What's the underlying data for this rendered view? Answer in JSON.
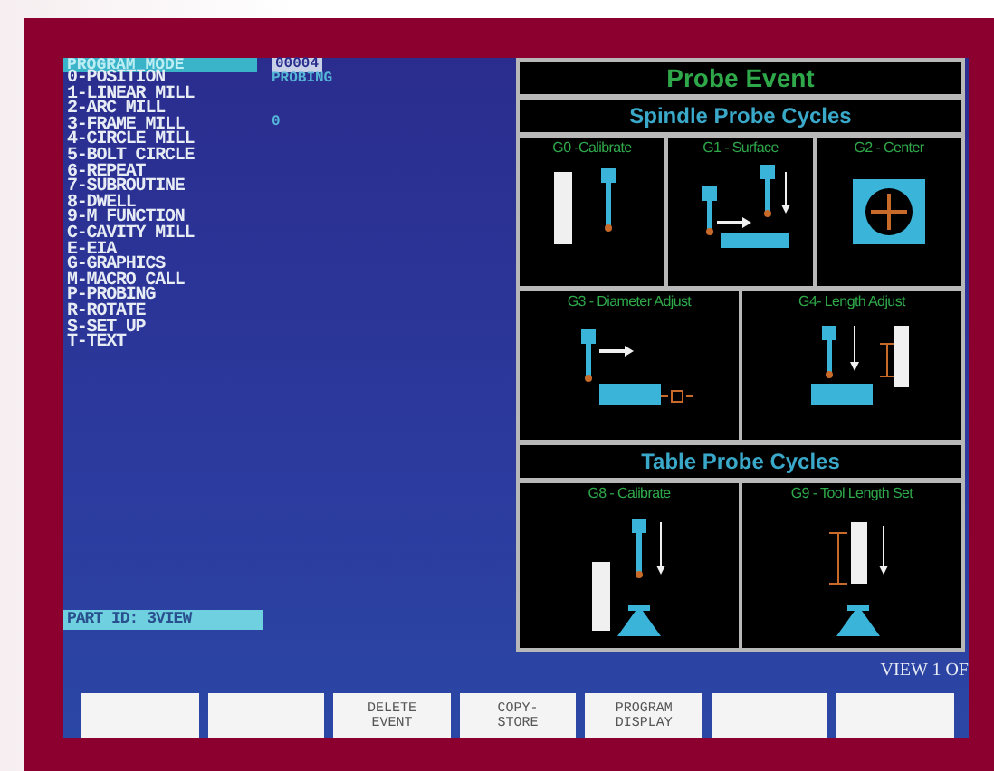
{
  "screen": {
    "mode_title": "PROGRAM MODE",
    "program_number": "00004",
    "program_status": "PROBING",
    "line_number": "0",
    "menu_groups": [
      {
        "items": [
          {
            "label": "0-POSITION"
          },
          {
            "label": "1-LINEAR MILL"
          },
          {
            "label": "2-ARC MILL"
          },
          {
            "label": "3-FRAME MILL"
          },
          {
            "label": "4-CIRCLE MILL"
          },
          {
            "label": "5-BOLT CIRCLE"
          },
          {
            "label": "6-REPEAT"
          },
          {
            "label": "7-SUBROUTINE"
          },
          {
            "label": "8-DWELL"
          },
          {
            "label": "9-M FUNCTION"
          }
        ]
      },
      {
        "items": [
          {
            "label": "C-CAVITY MILL"
          },
          {
            "label": "E-EIA"
          },
          {
            "label": "G-GRAPHICS"
          },
          {
            "label": "M-MACRO CALL"
          },
          {
            "label": "P-PROBING"
          },
          {
            "label": "R-ROTATE"
          },
          {
            "label": "S-SET UP"
          },
          {
            "label": "T-TEXT"
          }
        ]
      }
    ],
    "part_id": "PART ID: 3VIEW",
    "probe_panel": {
      "title": "Probe Event",
      "sections": [
        {
          "title": "Spindle Probe Cycles",
          "tile_groups": [
            {
              "tiles": [
                {
                  "label": "G0 -Calibrate",
                  "kind": "spindle-calibrate"
                },
                {
                  "label": "G1 - Surface",
                  "kind": "surface"
                },
                {
                  "label": "G2 - Center",
                  "kind": "center"
                }
              ]
            },
            {
              "tiles": [
                {
                  "label": "G3 - Diameter Adjust",
                  "kind": "diameter"
                },
                {
                  "label": "G4- Length Adjust",
                  "kind": "length"
                }
              ]
            }
          ]
        },
        {
          "title": "Table Probe Cycles",
          "tile_groups": [
            {
              "tiles": [
                {
                  "label": "G8 - Calibrate",
                  "kind": "table-calibrate"
                },
                {
                  "label": "G9 - Tool Length Set",
                  "kind": "tool-length"
                }
              ]
            }
          ]
        }
      ]
    },
    "view_label": "VIEW 1 OF",
    "softkeys": [
      {
        "kind": "blank"
      },
      {
        "kind": "blank"
      },
      {
        "kind": "labeled",
        "lines": [
          "DELETE",
          "EVENT"
        ]
      },
      {
        "kind": "labeled",
        "lines": [
          "COPY-",
          "STORE"
        ]
      },
      {
        "kind": "labeled",
        "lines": [
          "PROGRAM",
          "DISPLAY"
        ]
      },
      {
        "kind": "blank"
      },
      {
        "kind": "blank"
      }
    ]
  }
}
